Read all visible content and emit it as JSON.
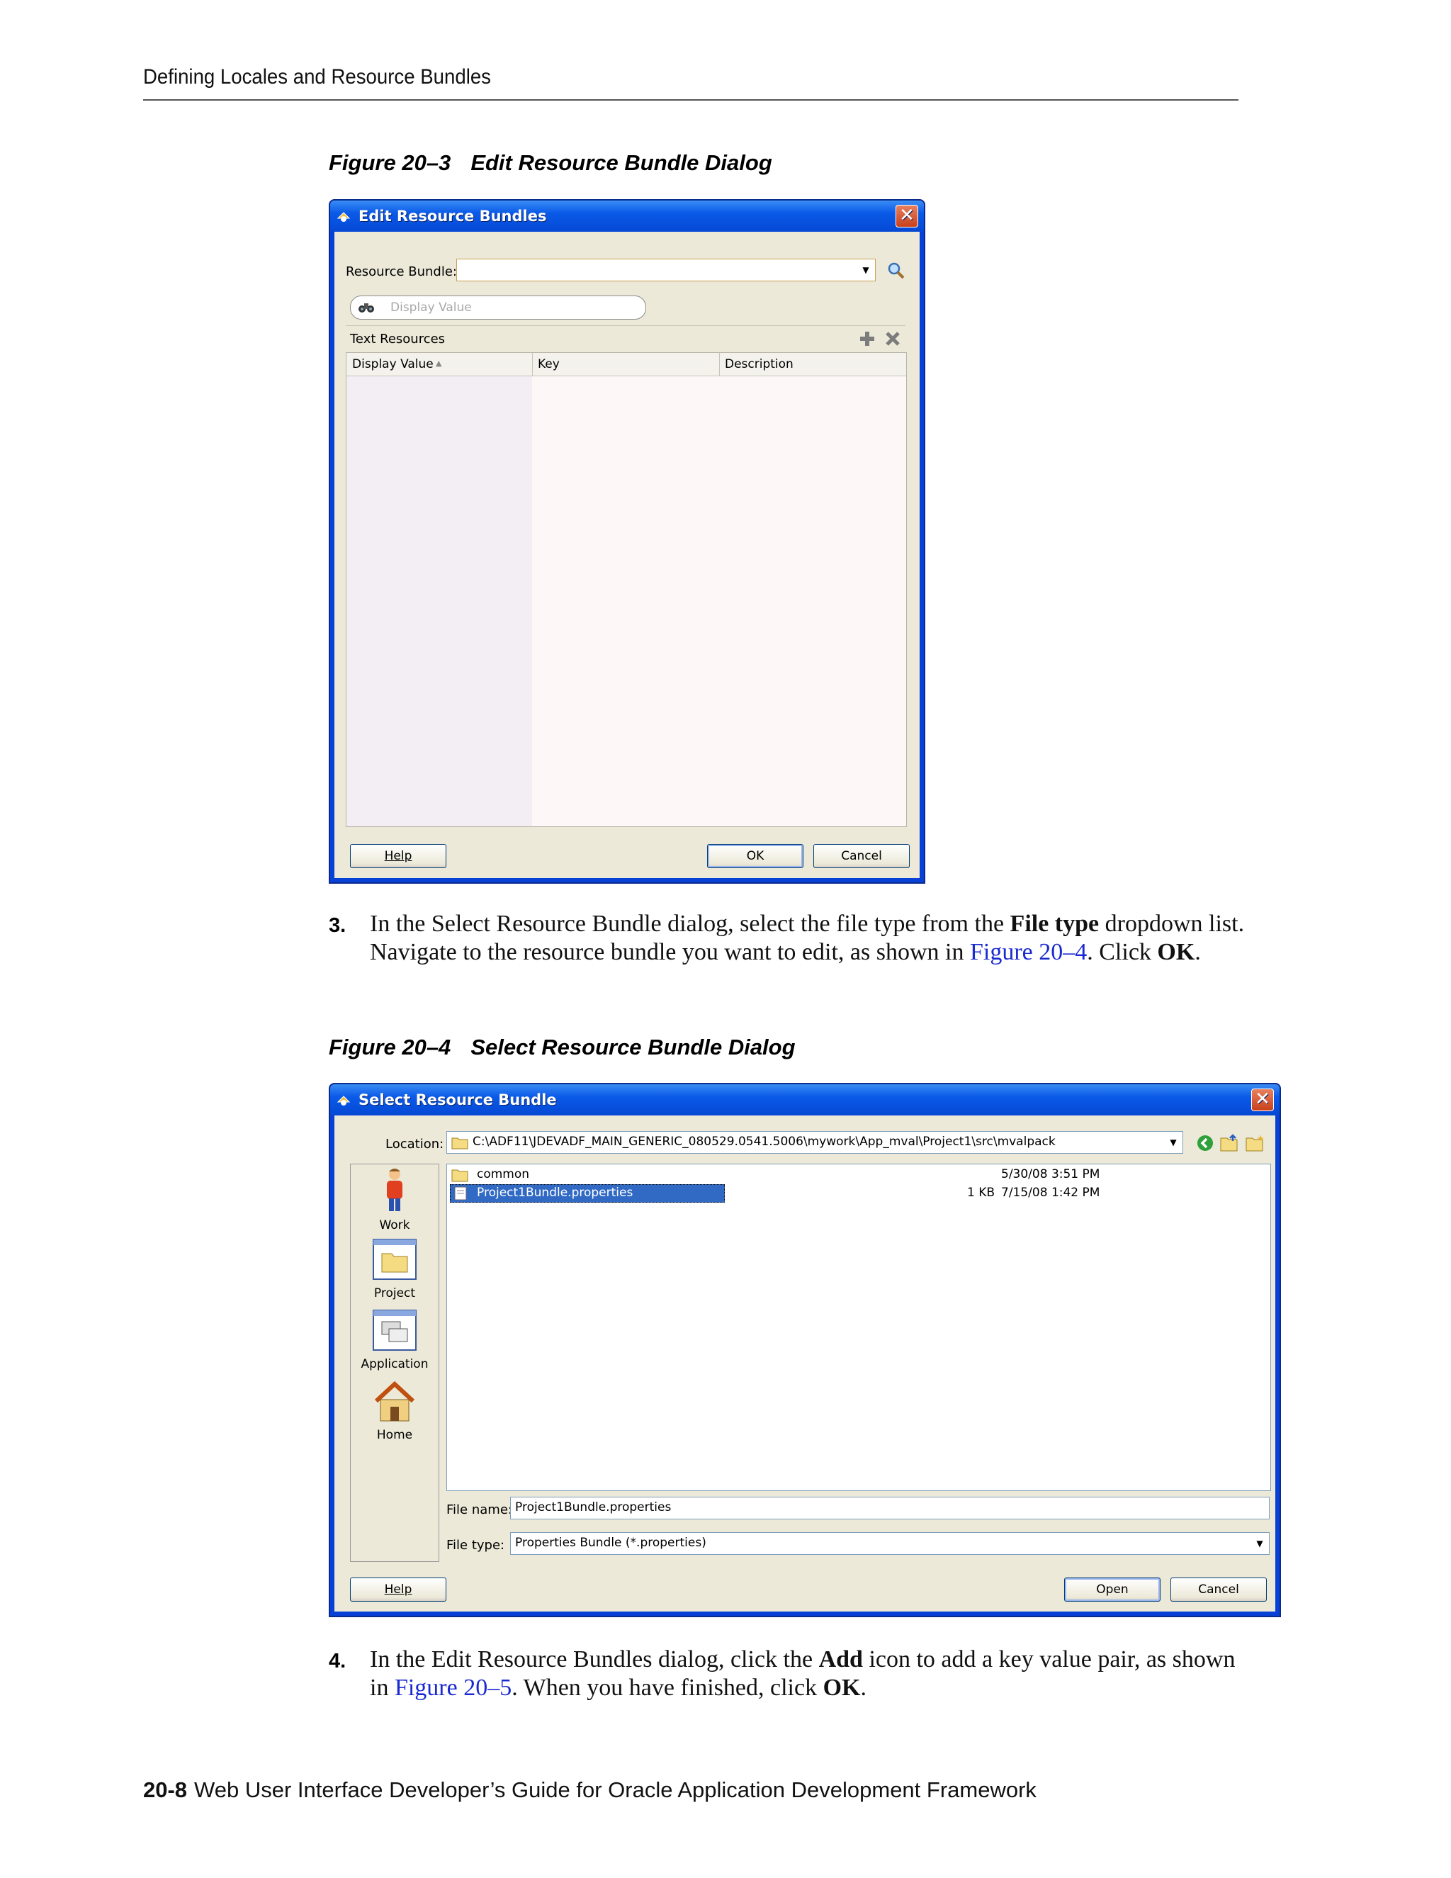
{
  "running_header": "Defining Locales and Resource Bundles",
  "figure3": {
    "number": "Figure 20–3",
    "title": "Edit Resource Bundle Dialog",
    "dialog": {
      "title": "Edit Resource Bundles",
      "resource_bundle_label": "Resource Bundle:",
      "resource_bundle_value": "",
      "search_placeholder": "Display Value",
      "section_label": "Text Resources",
      "columns": [
        "Display Value",
        "Key",
        "Description"
      ],
      "help_label": "Help",
      "ok_label": "OK",
      "cancel_label": "Cancel"
    }
  },
  "step3": {
    "number": "3.",
    "text_before": "In the Select Resource Bundle dialog, select the file type from the ",
    "bold1": "File type",
    "text_mid": " dropdown list. Navigate to the resource bundle you want to edit, as shown in ",
    "link": "Figure 20–4",
    "text_after": ". Click ",
    "bold2": "OK",
    "end": "."
  },
  "figure4": {
    "number": "Figure 20–4",
    "title": "Select Resource Bundle Dialog",
    "dialog": {
      "title": "Select Resource Bundle",
      "location_label": "Location:",
      "location_value": "C:\\ADF11\\JDEVADF_MAIN_GENERIC_080529.0541.5006\\mywork\\App_mval\\Project1\\src\\mvalpack",
      "places": [
        "Work",
        "Project",
        "Application",
        "Home"
      ],
      "files": [
        {
          "name": "common",
          "size": "",
          "date": "5/30/08 3:51 PM"
        },
        {
          "name": "Project1Bundle.properties",
          "size": "1 KB",
          "date": "7/15/08 1:42 PM"
        }
      ],
      "file_name_label": "File name:",
      "file_name_value": "Project1Bundle.properties",
      "file_type_label": "File type:",
      "file_type_value": "Properties Bundle (*.properties)",
      "help_label": "Help",
      "open_label": "Open",
      "cancel_label": "Cancel"
    }
  },
  "step4": {
    "number": "4.",
    "text_before": "In the Edit Resource Bundles dialog, click the ",
    "bold1": "Add",
    "text_mid": " icon to add a key value pair, as shown in ",
    "link": "Figure 20–5",
    "text_after": ". When you have finished, click ",
    "bold2": "OK",
    "end": "."
  },
  "footer": {
    "page": "20-8",
    "title": "Web User Interface Developer’s Guide for Oracle Application Development Framework"
  }
}
